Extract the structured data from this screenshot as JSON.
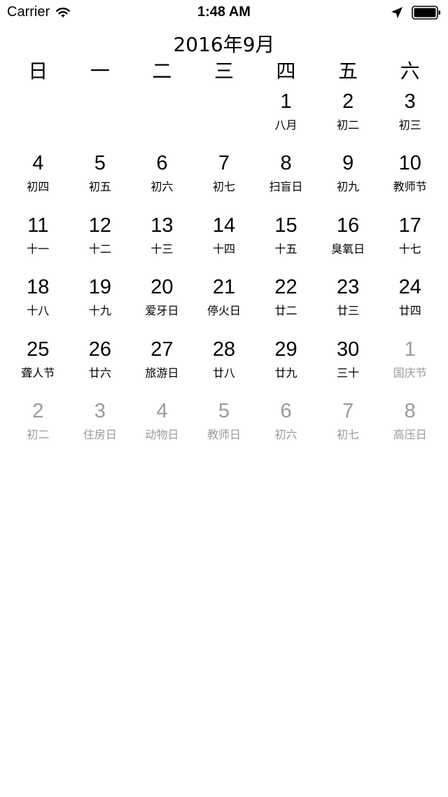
{
  "status_bar": {
    "carrier": "Carrier",
    "time": "1:48 AM",
    "icons": [
      "wifi-icon",
      "location-arrow-icon",
      "battery-icon"
    ]
  },
  "calendar": {
    "title": "2016年9月",
    "weekdays": [
      "日",
      "一",
      "二",
      "三",
      "四",
      "五",
      "六"
    ],
    "muted_color": "#9a9a9a",
    "cells": [
      {
        "day": "",
        "lunar": "",
        "other": false
      },
      {
        "day": "",
        "lunar": "",
        "other": false
      },
      {
        "day": "",
        "lunar": "",
        "other": false
      },
      {
        "day": "",
        "lunar": "",
        "other": false
      },
      {
        "day": "1",
        "lunar": "八月",
        "other": false
      },
      {
        "day": "2",
        "lunar": "初二",
        "other": false
      },
      {
        "day": "3",
        "lunar": "初三",
        "other": false
      },
      {
        "day": "4",
        "lunar": "初四",
        "other": false
      },
      {
        "day": "5",
        "lunar": "初五",
        "other": false
      },
      {
        "day": "6",
        "lunar": "初六",
        "other": false
      },
      {
        "day": "7",
        "lunar": "初七",
        "other": false
      },
      {
        "day": "8",
        "lunar": "扫盲日",
        "other": false
      },
      {
        "day": "9",
        "lunar": "初九",
        "other": false
      },
      {
        "day": "10",
        "lunar": "教师节",
        "other": false
      },
      {
        "day": "11",
        "lunar": "十一",
        "other": false
      },
      {
        "day": "12",
        "lunar": "十二",
        "other": false
      },
      {
        "day": "13",
        "lunar": "十三",
        "other": false
      },
      {
        "day": "14",
        "lunar": "十四",
        "other": false
      },
      {
        "day": "15",
        "lunar": "十五",
        "other": false
      },
      {
        "day": "16",
        "lunar": "臭氧日",
        "other": false
      },
      {
        "day": "17",
        "lunar": "十七",
        "other": false
      },
      {
        "day": "18",
        "lunar": "十八",
        "other": false
      },
      {
        "day": "19",
        "lunar": "十九",
        "other": false
      },
      {
        "day": "20",
        "lunar": "爱牙日",
        "other": false
      },
      {
        "day": "21",
        "lunar": "停火日",
        "other": false
      },
      {
        "day": "22",
        "lunar": "廿二",
        "other": false
      },
      {
        "day": "23",
        "lunar": "廿三",
        "other": false
      },
      {
        "day": "24",
        "lunar": "廿四",
        "other": false
      },
      {
        "day": "25",
        "lunar": "聋人节",
        "other": false
      },
      {
        "day": "26",
        "lunar": "廿六",
        "other": false
      },
      {
        "day": "27",
        "lunar": "旅游日",
        "other": false
      },
      {
        "day": "28",
        "lunar": "廿八",
        "other": false
      },
      {
        "day": "29",
        "lunar": "廿九",
        "other": false
      },
      {
        "day": "30",
        "lunar": "三十",
        "other": false
      },
      {
        "day": "1",
        "lunar": "国庆节",
        "other": true
      },
      {
        "day": "2",
        "lunar": "初二",
        "other": true
      },
      {
        "day": "3",
        "lunar": "住房日",
        "other": true
      },
      {
        "day": "4",
        "lunar": "动物日",
        "other": true
      },
      {
        "day": "5",
        "lunar": "教师日",
        "other": true
      },
      {
        "day": "6",
        "lunar": "初六",
        "other": true
      },
      {
        "day": "7",
        "lunar": "初七",
        "other": true
      },
      {
        "day": "8",
        "lunar": "高压日",
        "other": true
      }
    ]
  }
}
